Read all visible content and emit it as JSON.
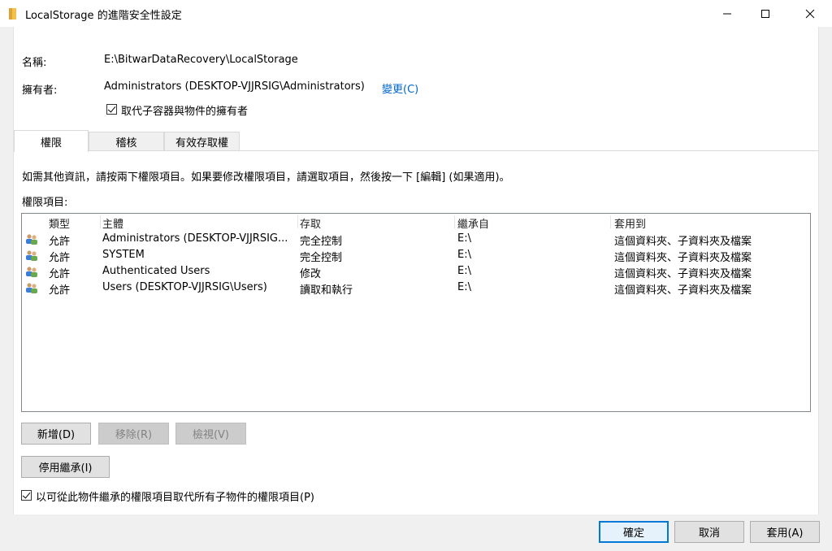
{
  "window": {
    "title": "LocalStorage 的進階安全性設定",
    "minimize": "—",
    "maximize": "☐",
    "close": "✕"
  },
  "info": {
    "name_label": "名稱:",
    "name_value": "E:\\BitwarDataRecovery\\LocalStorage",
    "owner_label": "擁有者:",
    "owner_value": "Administrators (DESKTOP-VJJRSIG\\Administrators)",
    "owner_change": "變更(C)",
    "replace_owner_label": "取代子容器與物件的擁有者",
    "replace_owner_checked": true
  },
  "tabs": [
    {
      "label": "權限",
      "active": true
    },
    {
      "label": "稽核",
      "active": false
    },
    {
      "label": "有效存取權",
      "active": false
    }
  ],
  "permissions": {
    "instructions": "如需其他資訊，請按兩下權限項目。如果要修改權限項目，請選取項目，然後按一下 [編輯] (如果適用)。",
    "entries_label": "權限項目:",
    "columns": [
      "類型",
      "主體",
      "存取",
      "繼承自",
      "套用到"
    ],
    "rows": [
      {
        "type": "允許",
        "principal": "Administrators (DESKTOP-VJJRSIG...",
        "access": "完全控制",
        "inherited": "E:\\",
        "applies": "這個資料夾、子資料夾及檔案"
      },
      {
        "type": "允許",
        "principal": "SYSTEM",
        "access": "完全控制",
        "inherited": "E:\\",
        "applies": "這個資料夾、子資料夾及檔案"
      },
      {
        "type": "允許",
        "principal": "Authenticated Users",
        "access": "修改",
        "inherited": "E:\\",
        "applies": "這個資料夾、子資料夾及檔案"
      },
      {
        "type": "允許",
        "principal": "Users (DESKTOP-VJJRSIG\\Users)",
        "access": "讀取和執行",
        "inherited": "E:\\",
        "applies": "這個資料夾、子資料夾及檔案"
      }
    ],
    "add_button": "新增(D)",
    "remove_button": "移除(R)",
    "view_button": "檢視(V)",
    "disable_inheritance_button": "停用繼承(I)",
    "replace_child_label": "以可從此物件繼承的權限項目取代所有子物件的權限項目(P)",
    "replace_child_checked": true
  },
  "footer": {
    "ok": "確定",
    "cancel": "取消",
    "apply": "套用(A)"
  },
  "colors": {
    "accent": "#0078d7",
    "link": "#0066cc"
  }
}
